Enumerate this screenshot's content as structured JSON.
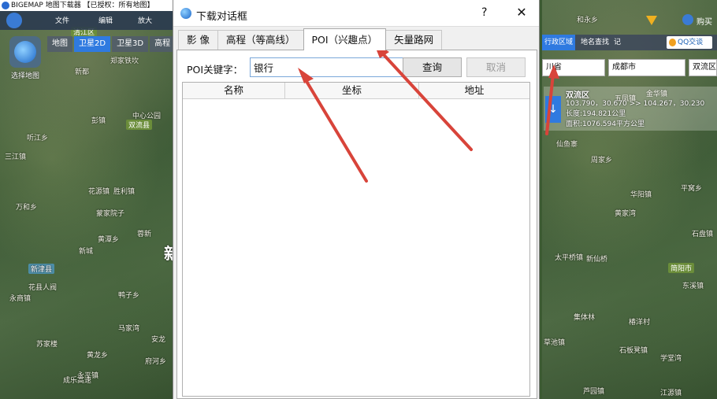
{
  "app": {
    "title": "BIGEMAP 地图下载器 【已授权：所有地图】",
    "toolbar": {
      "file": "文件",
      "edit": "编辑",
      "zoom_in": "放大"
    },
    "layers": [
      "地图",
      "卫星2D",
      "卫星3D",
      "高程"
    ],
    "layer_tag": "清江区",
    "earth_label": "选择地图",
    "buy_label": "购买"
  },
  "right_panel": {
    "tabs": [
      "行政区域",
      "地名查找",
      "记"
    ],
    "qq_label": "QQ交谈",
    "fields": [
      "川省",
      "成都市",
      "双流区"
    ],
    "info": {
      "name": "双流区",
      "coords": "103.790，30.670 >> 104.267，30.230",
      "length": "长度:194.821公里",
      "area": "面积:1076.594平方公里"
    }
  },
  "map_labels_left": [
    "郑家铁坎",
    "新都",
    "中心公园",
    "双流县",
    "彭镇",
    "听江乡",
    "三江镇",
    "花源镇",
    "胜利镇",
    "万和乡",
    "蒙家院子",
    "黄潭乡",
    "新津县",
    "新城",
    "花县人阀",
    "永商镇",
    "苏家楼",
    "永平镇",
    "府河乡",
    "安龙",
    "马家湾",
    "鸭子乡",
    "成乐高速",
    "黄龙乡",
    "蓉新",
    "新镇"
  ],
  "map_labels_right": [
    "和永乡",
    "仙鱼寨",
    "周家乡",
    "五凤镇",
    "金华镇",
    "华阳镇",
    "黄家湾",
    "平窝乡",
    "石盘镇",
    "太平桥镇",
    "新仙桥",
    "简阳市",
    "东溪镇",
    "集体林",
    "椿洋村",
    "草池镇",
    "石板凳镇",
    "学堂湾",
    "芦园镇",
    "江源镇"
  ],
  "dialog": {
    "title": "下载对话框",
    "help": "?",
    "close": "✕",
    "tabs": [
      "影 像",
      "高程（等高线）",
      "POI（兴趣点）",
      "矢量路网"
    ],
    "active_tab": 2,
    "keyword_label": "POI关键字：",
    "keyword_value": "银行",
    "query_button": "查询",
    "cancel_button": "取消",
    "columns": [
      "名称",
      "坐标",
      "地址"
    ]
  },
  "colors": {
    "annotation_arrow": "#d8443a",
    "active_blue": "#2f7ae0"
  }
}
